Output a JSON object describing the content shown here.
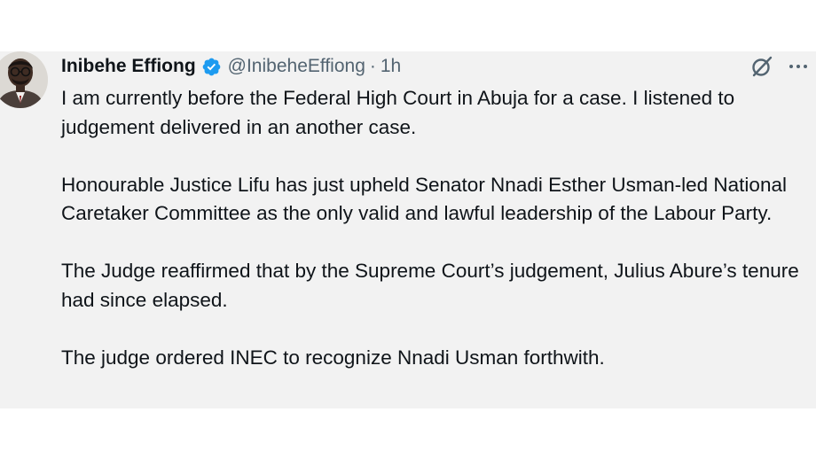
{
  "tweet": {
    "author_name": "Inibehe Effiong",
    "handle": "@InibeheEffiong",
    "separator": "·",
    "time": "1h",
    "paragraphs": [
      "I am currently before the Federal High Court in Abuja for a case. I listened to judgement delivered in an another case.",
      "Honourable Justice Lifu has just upheld Senator Nnadi Esther Usman-led National Caretaker Committee as the only valid and lawful leadership of the Labour Party.",
      "The Judge reaffirmed that by the Supreme Court’s judgement, Julius Abure’s tenure had since elapsed.",
      "The judge ordered INEC to recognize Nnadi Usman forthwith."
    ]
  },
  "icons": {
    "verified": "verified-badge-icon",
    "grok": "grok-icon",
    "more": "more-icon"
  },
  "colors": {
    "verified_blue": "#1d9bf0",
    "text": "#0f1419",
    "secondary_text": "#536471",
    "tweet_background": "#f2f2f2"
  }
}
